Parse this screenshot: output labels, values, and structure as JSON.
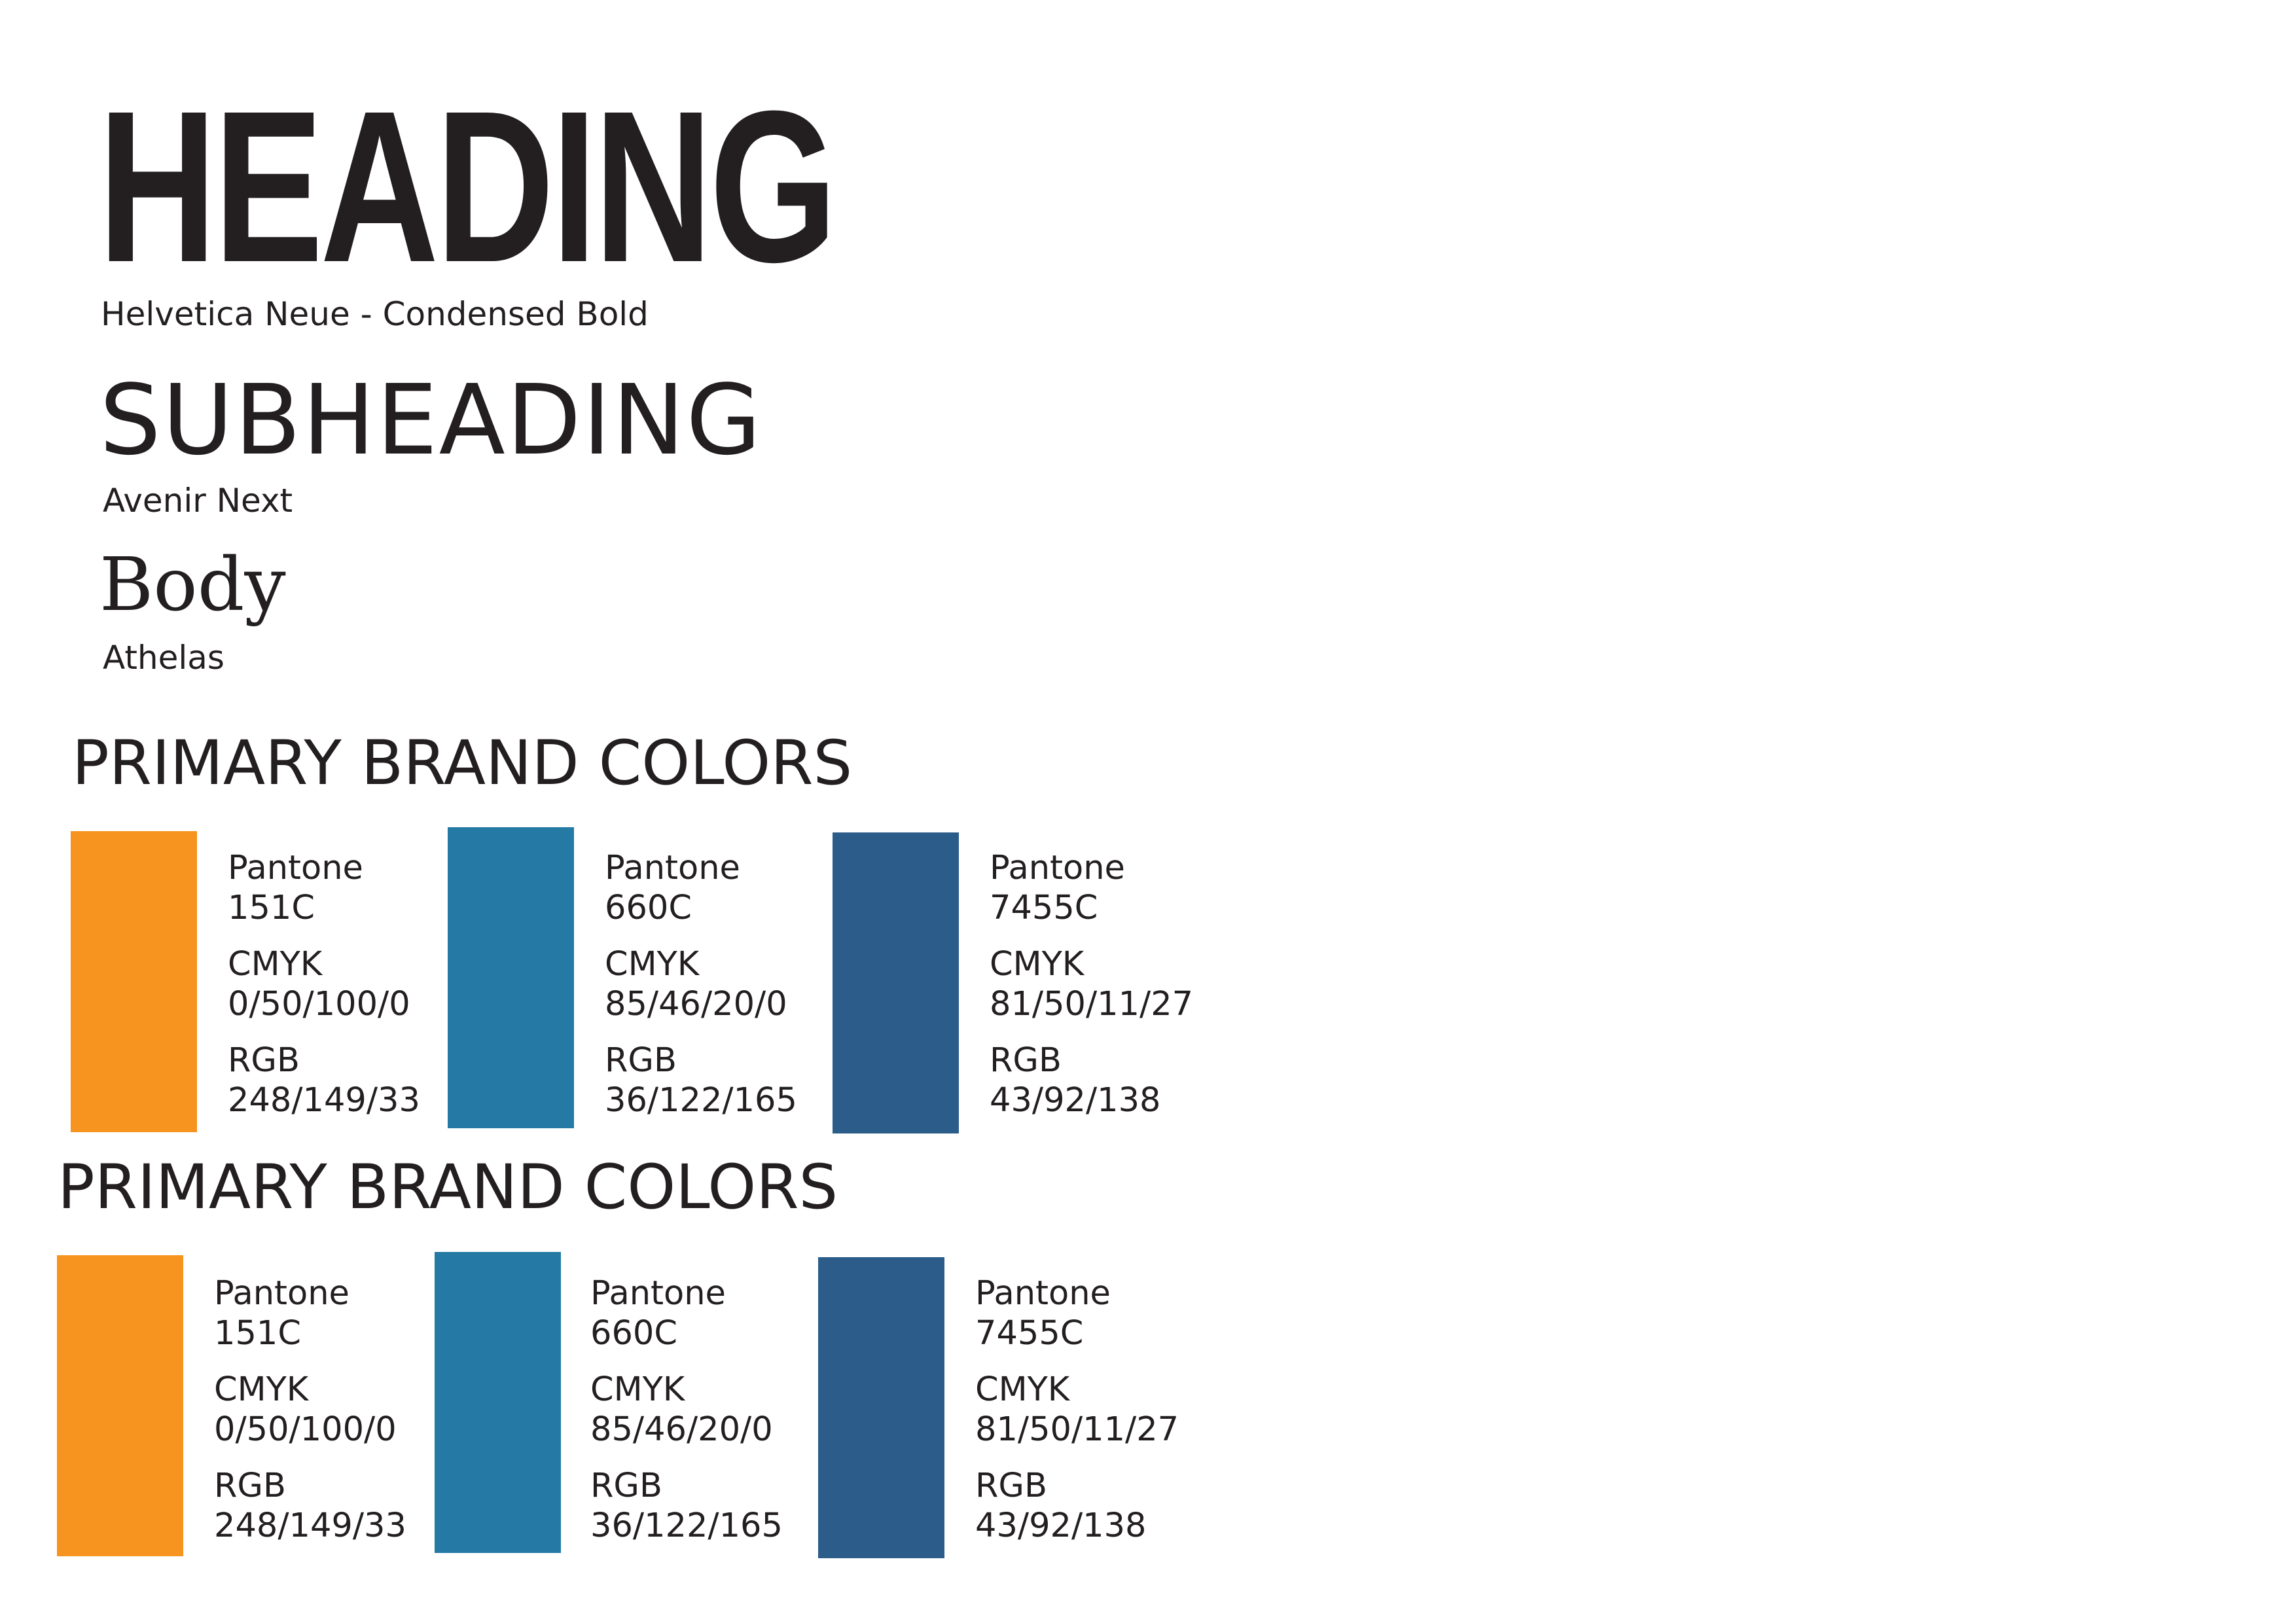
{
  "typography": {
    "heading": {
      "sample": "HEADING",
      "font_label": "Helvetica Neue - Condensed Bold"
    },
    "subheading": {
      "sample": "SUBHEADING",
      "font_label": "Avenir Next"
    },
    "body": {
      "sample": "Body",
      "font_label": "Athelas"
    }
  },
  "palettes": [
    {
      "title": "PRIMARY BRAND COLORS",
      "colors": [
        {
          "hex": "#f7941f",
          "pantone_label": "Pantone",
          "pantone": "151C",
          "cmyk_label": "CMYK",
          "cmyk": "0/50/100/0",
          "rgb_label": "RGB",
          "rgb": "248/149/33"
        },
        {
          "hex": "#247aa5",
          "pantone_label": "Pantone",
          "pantone": "660C",
          "cmyk_label": "CMYK",
          "cmyk": "85/46/20/0",
          "rgb_label": "RGB",
          "rgb": "36/122/165"
        },
        {
          "hex": "#2b5c8a",
          "pantone_label": "Pantone",
          "pantone": "7455C",
          "cmyk_label": "CMYK",
          "cmyk": "81/50/11/27",
          "rgb_label": "RGB",
          "rgb": "43/92/138"
        }
      ]
    },
    {
      "title": "PRIMARY BRAND COLORS",
      "colors": [
        {
          "hex": "#f7941f",
          "pantone_label": "Pantone",
          "pantone": "151C",
          "cmyk_label": "CMYK",
          "cmyk": "0/50/100/0",
          "rgb_label": "RGB",
          "rgb": "248/149/33"
        },
        {
          "hex": "#247aa5",
          "pantone_label": "Pantone",
          "pantone": "660C",
          "cmyk_label": "CMYK",
          "cmyk": "85/46/20/0",
          "rgb_label": "RGB",
          "rgb": "36/122/165"
        },
        {
          "hex": "#2b5c8a",
          "pantone_label": "Pantone",
          "pantone": "7455C",
          "cmyk_label": "CMYK",
          "cmyk": "81/50/11/27",
          "rgb_label": "RGB",
          "rgb": "43/92/138"
        }
      ]
    }
  ]
}
